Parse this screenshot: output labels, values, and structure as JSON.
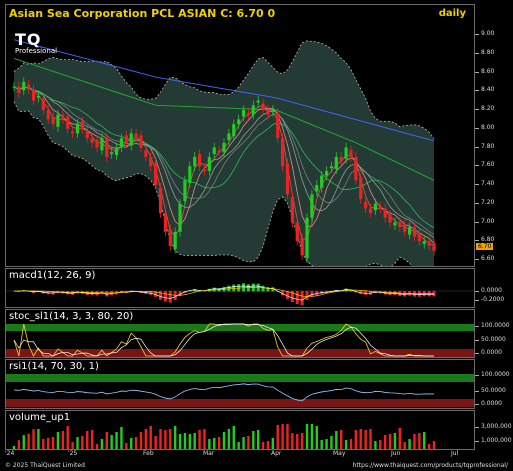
{
  "header": {
    "ticker_name": "Asian Sea Corporation PCL ASIAN",
    "close_label": "C:",
    "close_value": "6.70",
    "change": "0",
    "period": "daily"
  },
  "logo": {
    "mark": "TQ",
    "sub": "Professional"
  },
  "price_axis": [
    "9.00",
    "8.80",
    "8.60",
    "8.40",
    "8.20",
    "8.00",
    "7.80",
    "7.60",
    "7.40",
    "7.20",
    "7.00",
    "6.80",
    "6.60"
  ],
  "price_tag": "6.70",
  "panels": {
    "macd": {
      "title": "macd1(12, 26, 9)",
      "ticks": [
        "0.0000",
        "-0.2000"
      ]
    },
    "stoch": {
      "title": "stoc_sl1(14, 3, 3, 80, 20)",
      "ticks": [
        "100.0000",
        "50.0000",
        "0.0000"
      ]
    },
    "rsi": {
      "title": "rsi1(14, 70, 30, 1)",
      "ticks": [
        "100.0000",
        "50.0000",
        "0.0000"
      ]
    },
    "volume": {
      "title": "volume_up1",
      "ticks": [
        "3,000,000",
        "1,000,000"
      ]
    }
  },
  "x_axis": [
    "'24",
    "'25",
    "Feb",
    "Mar",
    "Apr",
    "May",
    "Jun",
    "Jul"
  ],
  "footer": {
    "copyright": "© 2025 ThaiQuest Limited",
    "url": "https://www.thaiquest.com/products/tqprofessional/"
  },
  "colors": {
    "up": "#22cc22",
    "down": "#ee2222",
    "header": "#f0d000",
    "band_fill": "#2f4f45"
  },
  "chart_data": {
    "type": "candlestick",
    "title": "Asian Sea Corporation PCL ASIAN",
    "ylim": [
      6.5,
      9.1
    ],
    "close": [
      8.45,
      8.38,
      8.5,
      8.42,
      8.3,
      8.35,
      8.2,
      8.1,
      8.05,
      8.15,
      8.1,
      8.0,
      7.95,
      8.05,
      8.0,
      7.9,
      7.85,
      7.8,
      7.9,
      7.7,
      7.75,
      7.8,
      7.9,
      7.85,
      7.95,
      7.9,
      7.8,
      7.7,
      7.6,
      7.4,
      7.1,
      6.9,
      6.75,
      6.9,
      7.2,
      7.45,
      7.6,
      7.7,
      7.6,
      7.55,
      7.7,
      7.8,
      7.75,
      7.85,
      7.95,
      8.05,
      8.1,
      8.2,
      8.15,
      8.25,
      8.3,
      8.2,
      8.15,
      8.2,
      7.9,
      7.6,
      7.3,
      7.0,
      6.8,
      6.65,
      7.05,
      7.3,
      7.4,
      7.5,
      7.55,
      7.6,
      7.7,
      7.65,
      7.8,
      7.7,
      7.45,
      7.25,
      7.15,
      7.1,
      7.2,
      7.15,
      7.05,
      7.0,
      7.0,
      6.95,
      6.9,
      6.95,
      6.85,
      6.8,
      6.8,
      6.75,
      6.7
    ]
  }
}
